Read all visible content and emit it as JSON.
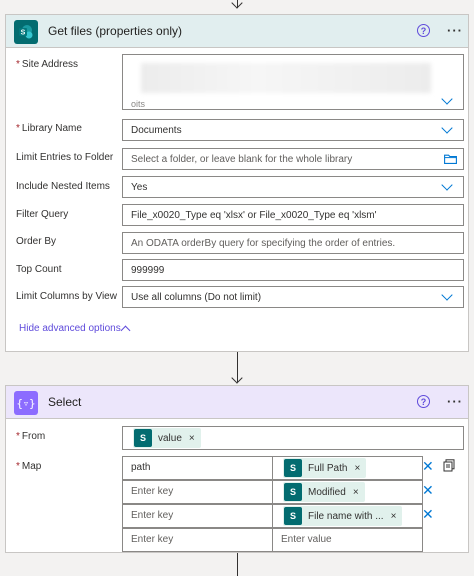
{
  "card1": {
    "title": "Get files (properties only)",
    "icon": "sharepoint-icon",
    "fields": {
      "site_address": {
        "label": "Site Address",
        "required": true,
        "value_partial": "oits"
      },
      "library_name": {
        "label": "Library Name",
        "required": true,
        "value": "Documents"
      },
      "limit_folder": {
        "label": "Limit Entries to Folder",
        "placeholder": "Select a folder, or leave blank for the whole library"
      },
      "nested": {
        "label": "Include Nested Items",
        "value": "Yes"
      },
      "filter": {
        "label": "Filter Query",
        "value": "File_x0020_Type eq 'xlsx' or File_x0020_Type eq 'xlsm'"
      },
      "order_by": {
        "label": "Order By",
        "placeholder": "An ODATA orderBy query for specifying the order of entries."
      },
      "top_count": {
        "label": "Top Count",
        "value": "999999"
      },
      "limit_columns": {
        "label": "Limit Columns by View",
        "value": "Use all columns (Do not limit)"
      }
    },
    "advanced": "Hide advanced options"
  },
  "card2": {
    "title": "Select",
    "icon": "data-operation-icon",
    "from": {
      "label": "From",
      "required": true,
      "token": "value"
    },
    "map": {
      "label": "Map",
      "required": true,
      "rows": [
        {
          "key": "path",
          "key_is_placeholder": false,
          "token": "Full Path"
        },
        {
          "key": "Enter key",
          "key_is_placeholder": true,
          "token": "Modified"
        },
        {
          "key": "Enter key",
          "key_is_placeholder": true,
          "token": "File name with ..."
        },
        {
          "key": "Enter key",
          "key_is_placeholder": true,
          "value_placeholder": "Enter value"
        }
      ]
    }
  },
  "colors": {
    "accent": "#0078d4",
    "sharepoint": "#036c70",
    "select_header": "#ece6fb",
    "sharepoint_header": "#e1eeef",
    "help": "#5f4bdb"
  }
}
